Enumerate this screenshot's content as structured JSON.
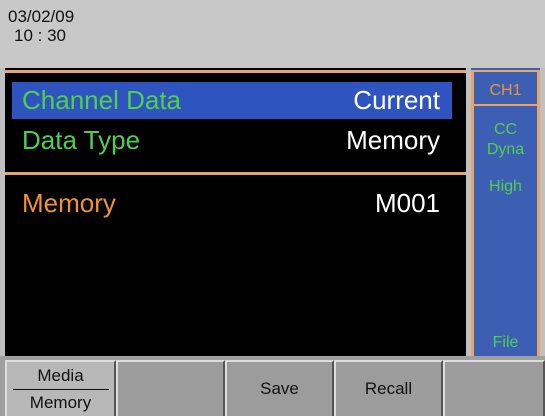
{
  "header": {
    "date": "03/02/09",
    "time": "10 : 30"
  },
  "main": {
    "channel_data_label": "Channel Data",
    "channel_data_value": "Current",
    "data_type_label": "Data Type",
    "data_type_value": "Memory",
    "memory_label": "Memory",
    "memory_value": "M001"
  },
  "side": {
    "channel": "CH1",
    "mode": "CC",
    "function": "Dyna",
    "range": "High",
    "footer": "File"
  },
  "softkeys": {
    "key1_top": "Media",
    "key1_bottom": "Memory",
    "key2": "",
    "key3": "Save",
    "key4": "Recall",
    "key5": ""
  },
  "colors": {
    "accent": "#e8a56b",
    "selection": "#2f54c0",
    "label_green": "#4fcf4f",
    "label_orange": "#f0922f",
    "side_panel": "#3d5fb3"
  }
}
